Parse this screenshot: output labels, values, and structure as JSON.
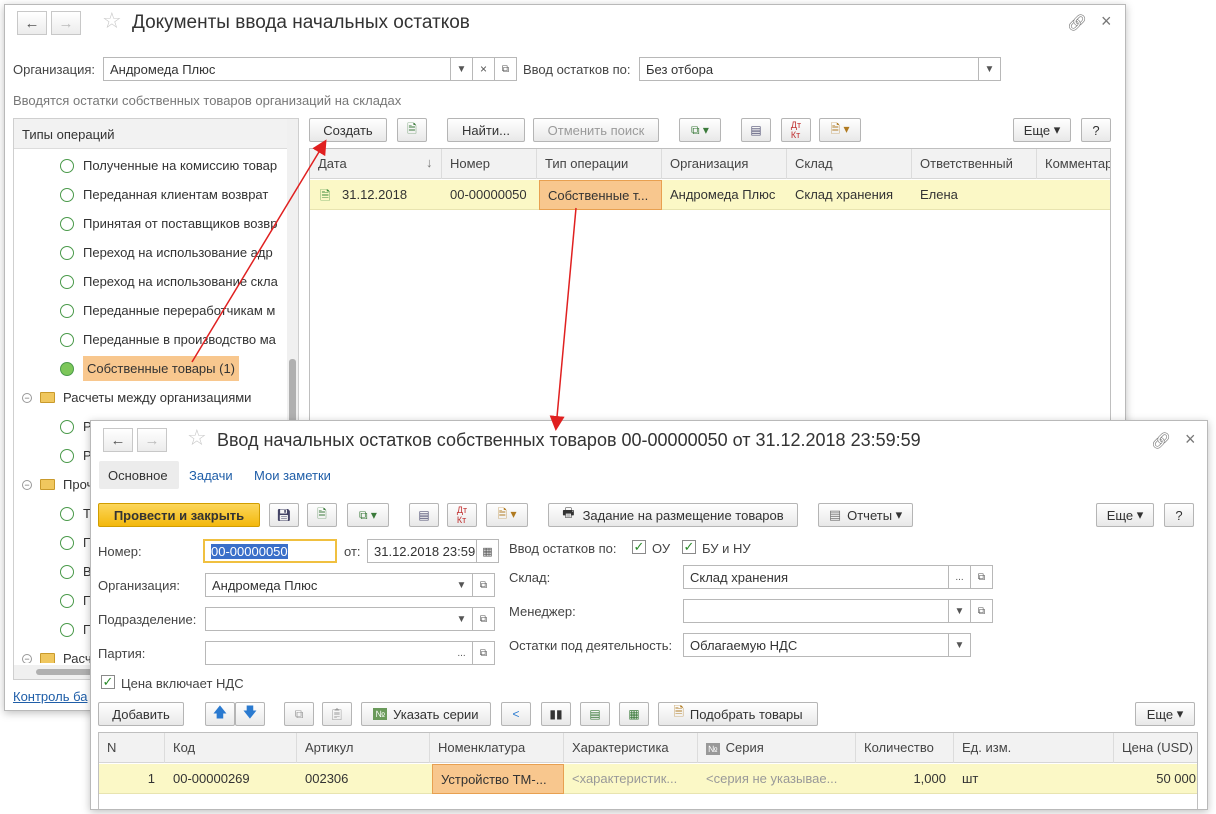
{
  "list_window": {
    "title": "Документы ввода начальных остатков",
    "org_label": "Организация:",
    "org_value": "Андромеда Плюс",
    "input_by_label": "Ввод остатков по:",
    "input_by_value": "Без отбора",
    "hint": "Вводятся остатки собственных товаров организаций на складах",
    "tree_header": "Типы операций",
    "tree_items": [
      {
        "label": "Полученные на комиссию товар",
        "type": "radio"
      },
      {
        "label": "Переданная клиентам возврат",
        "type": "radio"
      },
      {
        "label": "Принятая от поставщиков возвр",
        "type": "radio"
      },
      {
        "label": "Переход на использование адр",
        "type": "radio"
      },
      {
        "label": "Переход на использование скла",
        "type": "radio"
      },
      {
        "label": "Переданные переработчикам м",
        "type": "radio"
      },
      {
        "label": "Переданные в производство ма",
        "type": "radio"
      },
      {
        "label": "Собственные товары (1)",
        "type": "radio-selected"
      },
      {
        "label": "Расчеты между организациями",
        "type": "folder"
      },
      {
        "label": "Р",
        "type": "radio"
      },
      {
        "label": "Р",
        "type": "radio"
      },
      {
        "label": "Проч",
        "type": "folder"
      },
      {
        "label": "Т",
        "type": "radio"
      },
      {
        "label": "П",
        "type": "radio"
      },
      {
        "label": "В",
        "type": "radio"
      },
      {
        "label": "П",
        "type": "radio"
      },
      {
        "label": "П",
        "type": "radio"
      },
      {
        "label": "Расч",
        "type": "folder"
      }
    ],
    "footer_link": "Контроль ба",
    "toolbar": {
      "create": "Создать",
      "find": "Найти...",
      "cancel_search": "Отменить поиск",
      "more": "Еще",
      "help": "?"
    },
    "columns": [
      "Дата",
      "Номер",
      "Тип операции",
      "Организация",
      "Склад",
      "Ответственный",
      "Комментар"
    ],
    "rows": [
      {
        "date": "31.12.2018",
        "number": "00-00000050",
        "op_type": "Собственные т...",
        "org": "Андромеда Плюс",
        "warehouse": "Склад хранения",
        "responsible": "Елена",
        "comment": ""
      }
    ]
  },
  "doc_window": {
    "title": "Ввод начальных остатков собственных товаров 00-00000050 от 31.12.2018 23:59:59",
    "tabs": [
      "Основное",
      "Задачи",
      "Мои заметки"
    ],
    "toolbar": {
      "post_close": "Провести и закрыть",
      "placement_task": "Задание на размещение товаров",
      "reports": "Отчеты",
      "more": "Еще",
      "help": "?"
    },
    "number_label": "Номер:",
    "number_value": "00-00000050",
    "from_label": "от:",
    "date_value": "31.12.2018 23:59:59",
    "org_label": "Организация:",
    "org_value": "Андромеда Плюс",
    "division_label": "Подразделение:",
    "batch_label": "Партия:",
    "input_by_label": "Ввод остатков по:",
    "ou_label": "ОУ",
    "bu_label": "БУ и НУ",
    "warehouse_label": "Склад:",
    "warehouse_value": "Склад хранения",
    "manager_label": "Менеджер:",
    "activity_label": "Остатки под деятельность:",
    "activity_value": "Облагаемую НДС",
    "vat_included_label": "Цена включает НДС",
    "table_toolbar": {
      "add": "Добавить",
      "specify_series": "Указать серии",
      "pick_goods": "Подобрать товары",
      "more": "Еще"
    },
    "columns": [
      "N",
      "Код",
      "Артикул",
      "Номенклатура",
      "Характеристика",
      "Серия",
      "Количество",
      "Ед. изм.",
      "Цена (USD)"
    ],
    "rows": [
      {
        "n": "1",
        "code": "00-00000269",
        "article": "002306",
        "item": "Устройство ТМ-...",
        "characteristic": "<характеристик...",
        "series": "<серия не указывае...",
        "qty": "1,000",
        "unit": "шт",
        "price": "50 000"
      }
    ]
  },
  "colors": {
    "primary_button": "#f3b80c",
    "selected_cell": "#f8c78e",
    "row_highlight": "#fbf8c6",
    "arrow": "#e02020",
    "link": "#1f5ea8"
  }
}
